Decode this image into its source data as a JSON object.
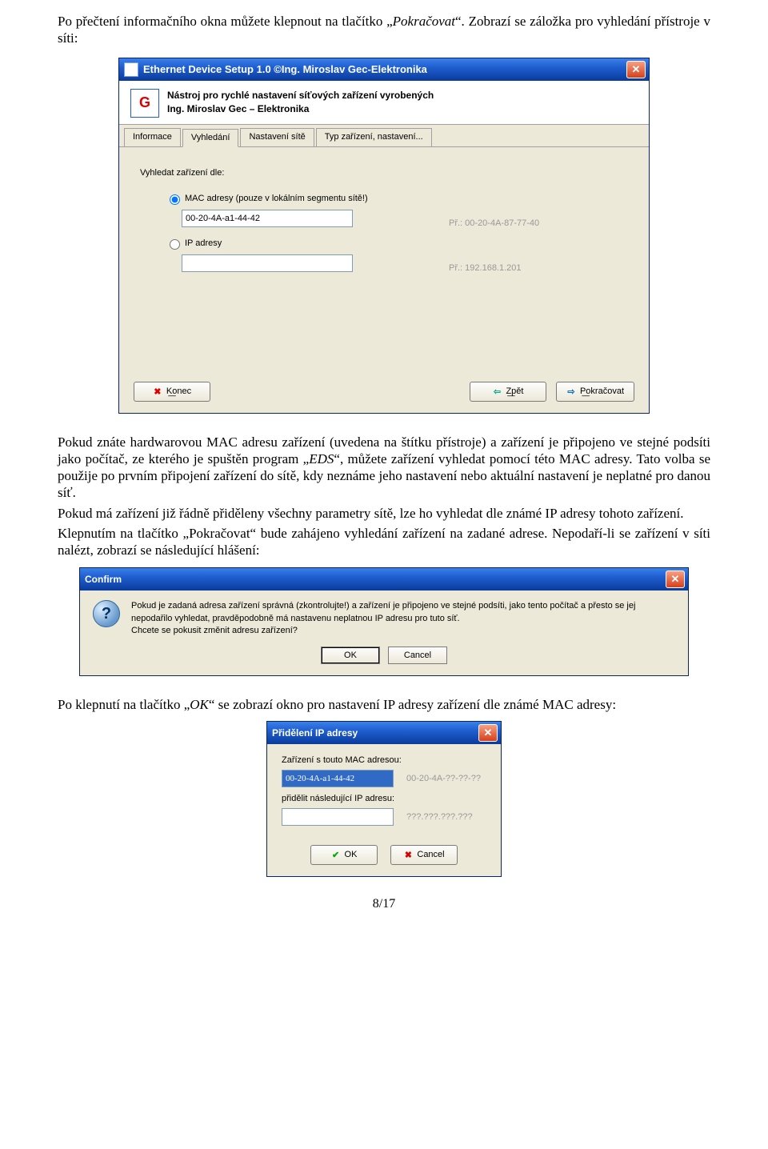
{
  "para": {
    "p1a": "Po přečtení informačního okna můžete klepnout na tlačítko „",
    "p1b": "Pokračovat",
    "p1c": "“. Zobrazí se záložka pro vyhledání přístroje v síti:",
    "p2a": "Pokud znáte hardwarovou MAC adresu zařízení (uvedena na štítku přístroje) a zařízení je připojeno ve stejné podsíti jako počítač, ze kterého je spuštěn program „",
    "p2b": "EDS",
    "p2c": "“, můžete zařízení vyhledat pomocí této MAC adresy. Tato volba se použije po prvním připojení zařízení do sítě, kdy neznáme jeho nastavení nebo aktuální nastavení je neplatné pro danou síť.",
    "p3": "Pokud má zařízení již řádně přiděleny všechny parametry sítě, lze ho vyhledat dle známé IP adresy tohoto zařízení.",
    "p4": "Klepnutím na tlačítko „Pokračovat“ bude zahájeno vyhledání zařízení na zadané adrese. Nepodaří-li se zařízení v síti nalézt, zobrazí se následující hlášení:",
    "p5a": "Po klepnutí na tlačítko „",
    "p5b": "OK",
    "p5c": "“ se zobrazí okno pro nastavení IP adresy zařízení dle známé MAC adresy:"
  },
  "win1": {
    "title": "Ethernet Device Setup  1.0 ©Ing. Miroslav Gec-Elektronika",
    "banner1": "Nástroj pro rychlé nastavení síťových zařízení vyrobených",
    "banner2": "Ing. Miroslav Gec – Elektronika",
    "tabs": [
      "Informace",
      "Vyhledání",
      "Nastavení sítě",
      "Typ zařízení, nastavení..."
    ],
    "search_label": "Vyhledat zařízení dle:",
    "radio_mac": "MAC adresy (pouze v lokálním segmentu sítě!)",
    "mac_value": "00-20-4A-a1-44-42",
    "mac_example": "Př.: 00-20-4A-87-77-40",
    "radio_ip": "IP adresy",
    "ip_value": "",
    "ip_example": "Př.: 192.168.1.201",
    "btn_left": "K͟onec",
    "btn_back": "Z͟pět",
    "btn_next": "P͟okračovat"
  },
  "confirm": {
    "title": "Confirm",
    "line1": "Pokud je zadaná adresa zařízení správná (zkontrolujte!) a zařízení je připojeno ve stejné podsíti, jako tento počítač a přesto se jej nepodařilo vyhledat, pravděpodobně má nastavenu neplatnou IP adresu pro tuto síť.",
    "line2": "Chcete se pokusit změnit adresu zařízení?",
    "ok": "OK",
    "cancel": "Cancel"
  },
  "assign": {
    "title": "Přidělení IP adresy",
    "lbl1": "Zařízení s touto MAC adresou:",
    "mac": "00-20-4A-a1-44-42",
    "mac_hint": "00-20-4A-??-??-??",
    "lbl2": "přidělit následující IP adresu:",
    "ip": "",
    "ip_hint": "???.???.???.???",
    "ok": "OK",
    "cancel": "Cancel"
  },
  "page_number": "8/17"
}
